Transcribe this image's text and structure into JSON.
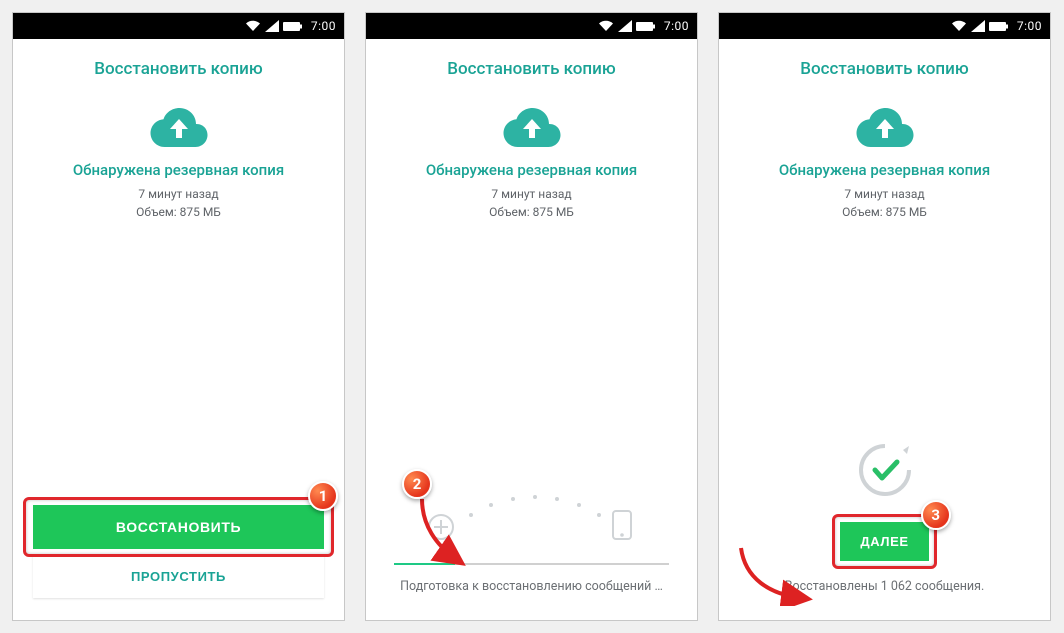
{
  "colors": {
    "accent_teal": "#1aa395",
    "accent_green": "#1ec659",
    "callout": "#e5341c",
    "highlight_border": "#e0272c"
  },
  "status": {
    "time": "7:00"
  },
  "common": {
    "screen_title": "Восстановить копию",
    "backup_heading": "Обнаружена резервная копия",
    "time_ago": "7 минут назад",
    "size_line": "Объем: 875 МБ"
  },
  "screen1": {
    "restore_label": "ВОССТАНОВИТЬ",
    "skip_label": "ПРОПУСТИТЬ",
    "callout": "1"
  },
  "screen2": {
    "progress_text": "Подготовка к восстановлению сообщений …",
    "callout": "2"
  },
  "screen3": {
    "next_label": "ДАЛЕЕ",
    "done_text": "Восстановлены 1 062 сообщения.",
    "callout": "3"
  }
}
